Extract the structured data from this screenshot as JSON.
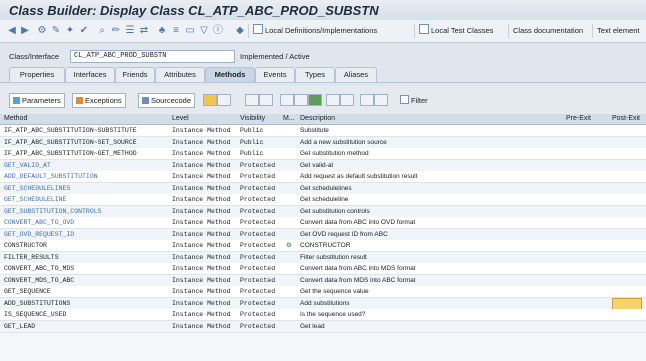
{
  "title": "Class Builder: Display Class CL_ATP_ABC_PROD_SUBSTN",
  "toolbar": {
    "local_definitions": "Local Definitions/Implementations",
    "local_test_classes": "Local Test Classes",
    "class_documentation": "Class documentation",
    "text_elements": "Text element"
  },
  "class_row": {
    "label": "Class/Interface",
    "value": "CL_ATP_ABC_PROD_SUBSTN",
    "status": "Implemented / Active"
  },
  "tabs": [
    "Properties",
    "Interfaces",
    "Friends",
    "Attributes",
    "Methods",
    "Events",
    "Types",
    "Aliases"
  ],
  "active_tab": "Methods",
  "panel": {
    "parameters": "Parameters",
    "exceptions": "Exceptions",
    "sourcecode": "Sourcecode",
    "filter": "Filter"
  },
  "columns": {
    "method": "Method",
    "level": "Level",
    "visibility": "Visibility",
    "m": "M...",
    "description": "Description",
    "pre_exit": "Pre-Exit",
    "post_exit": "Post-Exit"
  },
  "rows": [
    {
      "method": "IF_ATP_ABC_SUBSTITUTION~SUBSTITUTE",
      "level": "Instance Method",
      "vis": "Public",
      "desc": "Substitute"
    },
    {
      "method": "IF_ATP_ABC_SUBSTITUTION~SET_SOURCE",
      "level": "Instance Method",
      "vis": "Public",
      "desc": "Add a new substitution source"
    },
    {
      "method": "IF_ATP_ABC_SUBSTITUTION~GET_METHOD",
      "level": "Instance Method",
      "vis": "Public",
      "desc": "Get substitution method"
    },
    {
      "method": "GET_VALID_AT",
      "level": "Instance Method",
      "vis": "Protected",
      "desc": "Get valid-at"
    },
    {
      "method": "ADD_DEFAULT_SUBSTITUTION",
      "level": "Instance Method",
      "vis": "Protected",
      "desc": "Add request as default substitution result"
    },
    {
      "method": "GET_SCHEDULELINES",
      "level": "Instance Method",
      "vis": "Protected",
      "desc": "Get schedulelines"
    },
    {
      "method": "GET_SCHEDULELINE",
      "level": "Instance Method",
      "vis": "Protected",
      "desc": "Get scheduleline"
    },
    {
      "method": "GET_SUBSTITUTION_CONTROLS",
      "level": "Instance Method",
      "vis": "Protected",
      "desc": "Get substitution controls"
    },
    {
      "method": "CONVERT_ABC_TO_OVD",
      "level": "Instance Method",
      "vis": "Protected",
      "desc": "Convert data from ABC into OVD format"
    },
    {
      "method": "GET_OVD_REQUEST_ID",
      "level": "Instance Method",
      "vis": "Protected",
      "desc": "Get OVD request ID from ABC"
    },
    {
      "method": "CONSTRUCTOR",
      "level": "Instance Method",
      "vis": "Protected",
      "desc": "CONSTRUCTOR"
    },
    {
      "method": "FILTER_RESULTS",
      "level": "Instance Method",
      "vis": "Protected",
      "desc": "Filter substitution result"
    },
    {
      "method": "CONVERT_ABC_TO_MDS",
      "level": "Instance Method",
      "vis": "Protected",
      "desc": "Convert data from ABC into MDS format"
    },
    {
      "method": "CONVERT_MDS_TO_ABC",
      "level": "Instance Method",
      "vis": "Protected",
      "desc": "Convert data from MDS into ABC format"
    },
    {
      "method": "GET_SEQUENCE",
      "level": "Instance Method",
      "vis": "Protected",
      "desc": "Get the sequence value"
    },
    {
      "method": "ADD_SUBSTITUTIONS",
      "level": "Instance Method",
      "vis": "Protected",
      "desc": "Add substitutions"
    },
    {
      "method": "IS_SEQUENCE_USED",
      "level": "Instance Method",
      "vis": "Protected",
      "desc": "Is the sequence used?"
    },
    {
      "method": "GET_LEAD",
      "level": "Instance Method",
      "vis": "Protected",
      "desc": "Get lead"
    }
  ]
}
